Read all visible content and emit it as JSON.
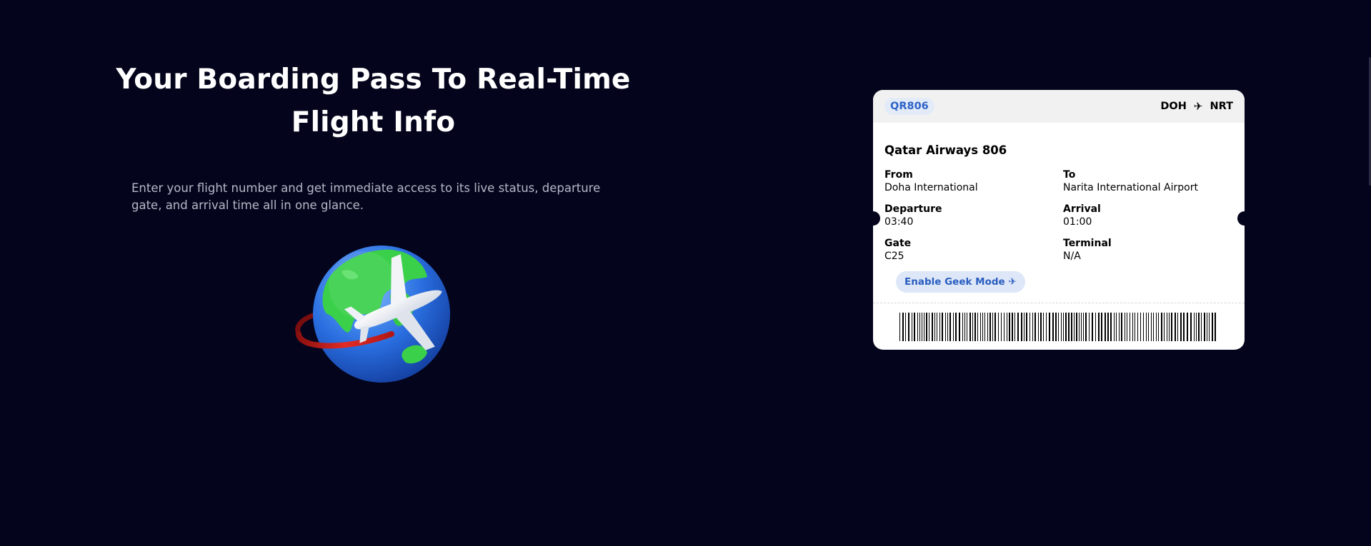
{
  "hero": {
    "title_line1": "Your Boarding Pass To Real-Time",
    "title_line2": "Flight Info",
    "description": "Enter your flight number and get immediate access to its live status, departure gate, and arrival time all in one glance."
  },
  "pass": {
    "flight_code": "QR806",
    "origin_code": "DOH",
    "destination_code": "NRT",
    "route_icon": "plane-icon",
    "airline_title": "Qatar Airways 806",
    "from_label": "From",
    "from_value": "Doha International",
    "to_label": "To",
    "to_value": "Narita International Airport",
    "departure_label": "Departure",
    "departure_value": "03:40",
    "arrival_label": "Arrival",
    "arrival_value": "01:00",
    "gate_label": "Gate",
    "gate_value": "C25",
    "terminal_label": "Terminal",
    "terminal_value": "N/A",
    "geek_button_label": "Enable Geek Mode ✈"
  },
  "colors": {
    "background": "#04041c",
    "accent_blue": "#2f63c8",
    "badge_bg": "#e3ebf8"
  }
}
